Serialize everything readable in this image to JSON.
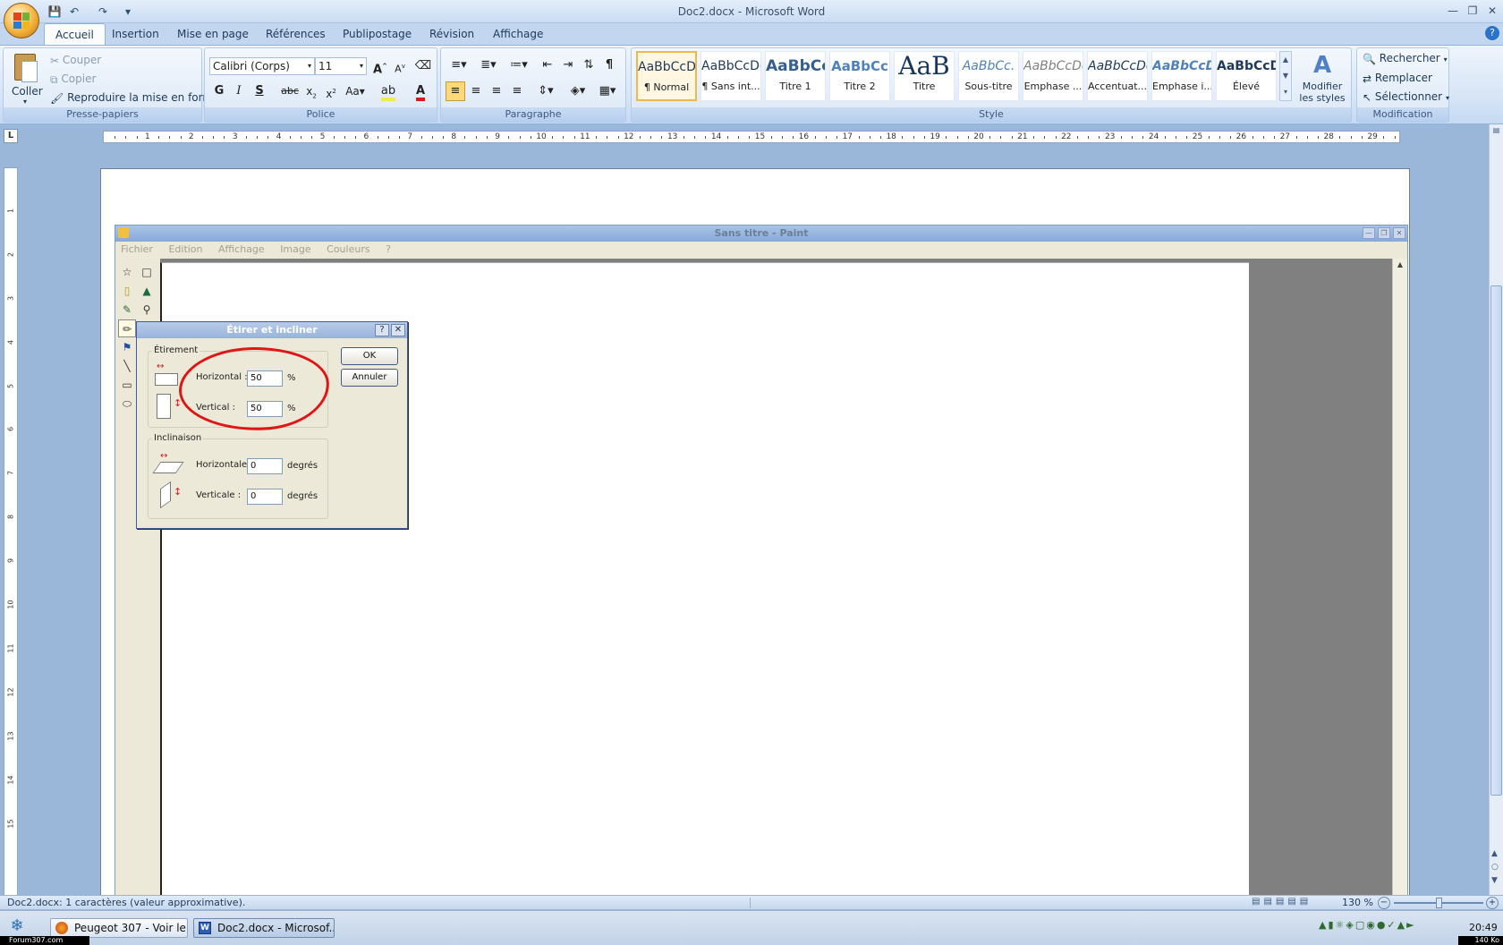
{
  "window": {
    "title": "Doc2.docx - Microsoft Word"
  },
  "quick_access": {
    "icons": [
      "save-icon",
      "undo-icon",
      "redo-icon",
      "customize-icon"
    ]
  },
  "tabs": [
    "Accueil",
    "Insertion",
    "Mise en page",
    "Références",
    "Publipostage",
    "Révision",
    "Affichage"
  ],
  "ribbon": {
    "clipboard": {
      "paste": "Coller",
      "cut": "Couper",
      "copy": "Copier",
      "format_painter": "Reproduire la mise en forme",
      "label": "Presse-papiers"
    },
    "font": {
      "name": "Calibri (Corps)",
      "size": "11",
      "label": "Police"
    },
    "paragraph": {
      "label": "Paragraphe"
    },
    "styles": {
      "label": "Style",
      "items": [
        {
          "sample": "AaBbCcDc",
          "name": "¶ Normal"
        },
        {
          "sample": "AaBbCcDc",
          "name": "¶ Sans int..."
        },
        {
          "sample": "AaBbCc",
          "name": "Titre 1"
        },
        {
          "sample": "AaBbCc",
          "name": "Titre 2"
        },
        {
          "sample": "AaB",
          "name": "Titre"
        },
        {
          "sample": "AaBbCc.",
          "name": "Sous-titre"
        },
        {
          "sample": "AaBbCcDc",
          "name": "Emphase ..."
        },
        {
          "sample": "AaBbCcDc",
          "name": "Accentuat..."
        },
        {
          "sample": "AaBbCcDc",
          "name": "Emphase i..."
        },
        {
          "sample": "AaBbCcDc",
          "name": "Élevé"
        }
      ],
      "change": "Modifier les styles"
    },
    "editing": {
      "find": "Rechercher",
      "replace": "Remplacer",
      "select": "Sélectionner",
      "label": "Modification"
    }
  },
  "ruler": {
    "numbers": [
      "1",
      "2",
      "3",
      "4",
      "5",
      "6",
      "7",
      "8",
      "9",
      "10",
      "11",
      "12",
      "13",
      "14",
      "15",
      "16",
      "17",
      "18",
      "19",
      "20",
      "21",
      "22",
      "23",
      "24",
      "25",
      "26",
      "27",
      "28",
      "29"
    ]
  },
  "paint": {
    "title": "Sans titre - Paint",
    "menu": [
      "Fichier",
      "Edition",
      "Affichage",
      "Image",
      "Couleurs",
      "?"
    ]
  },
  "dialog": {
    "title": "Étirer et incliner",
    "stretch_legend": "Étirement",
    "horizontal_label": "Horizontal :",
    "horizontal_value": "50",
    "vertical_label": "Vertical :",
    "vertical_value": "50",
    "percent": "%",
    "skew_legend": "Inclinaison",
    "skew_h_label": "Horizontale :",
    "skew_h_value": "0",
    "skew_v_label": "Verticale :",
    "skew_v_value": "0",
    "degrees": "degrés",
    "ok": "OK",
    "cancel": "Annuler"
  },
  "status": {
    "text": "Doc2.docx: 1 caractères (valeur approximative).",
    "zoom": "130 %"
  },
  "taskbar": {
    "buttons": [
      "Peugeot 307 - Voir le...",
      "Doc2.docx - Microsof..."
    ],
    "clock": "20:49",
    "watermark_left": "Forum307.com",
    "watermark_right": "140 Ko"
  },
  "colors": {
    "accent": "#1e395b",
    "annotation": "#e01515",
    "font_color": "#e01515",
    "highlight": "#f6e94a"
  }
}
